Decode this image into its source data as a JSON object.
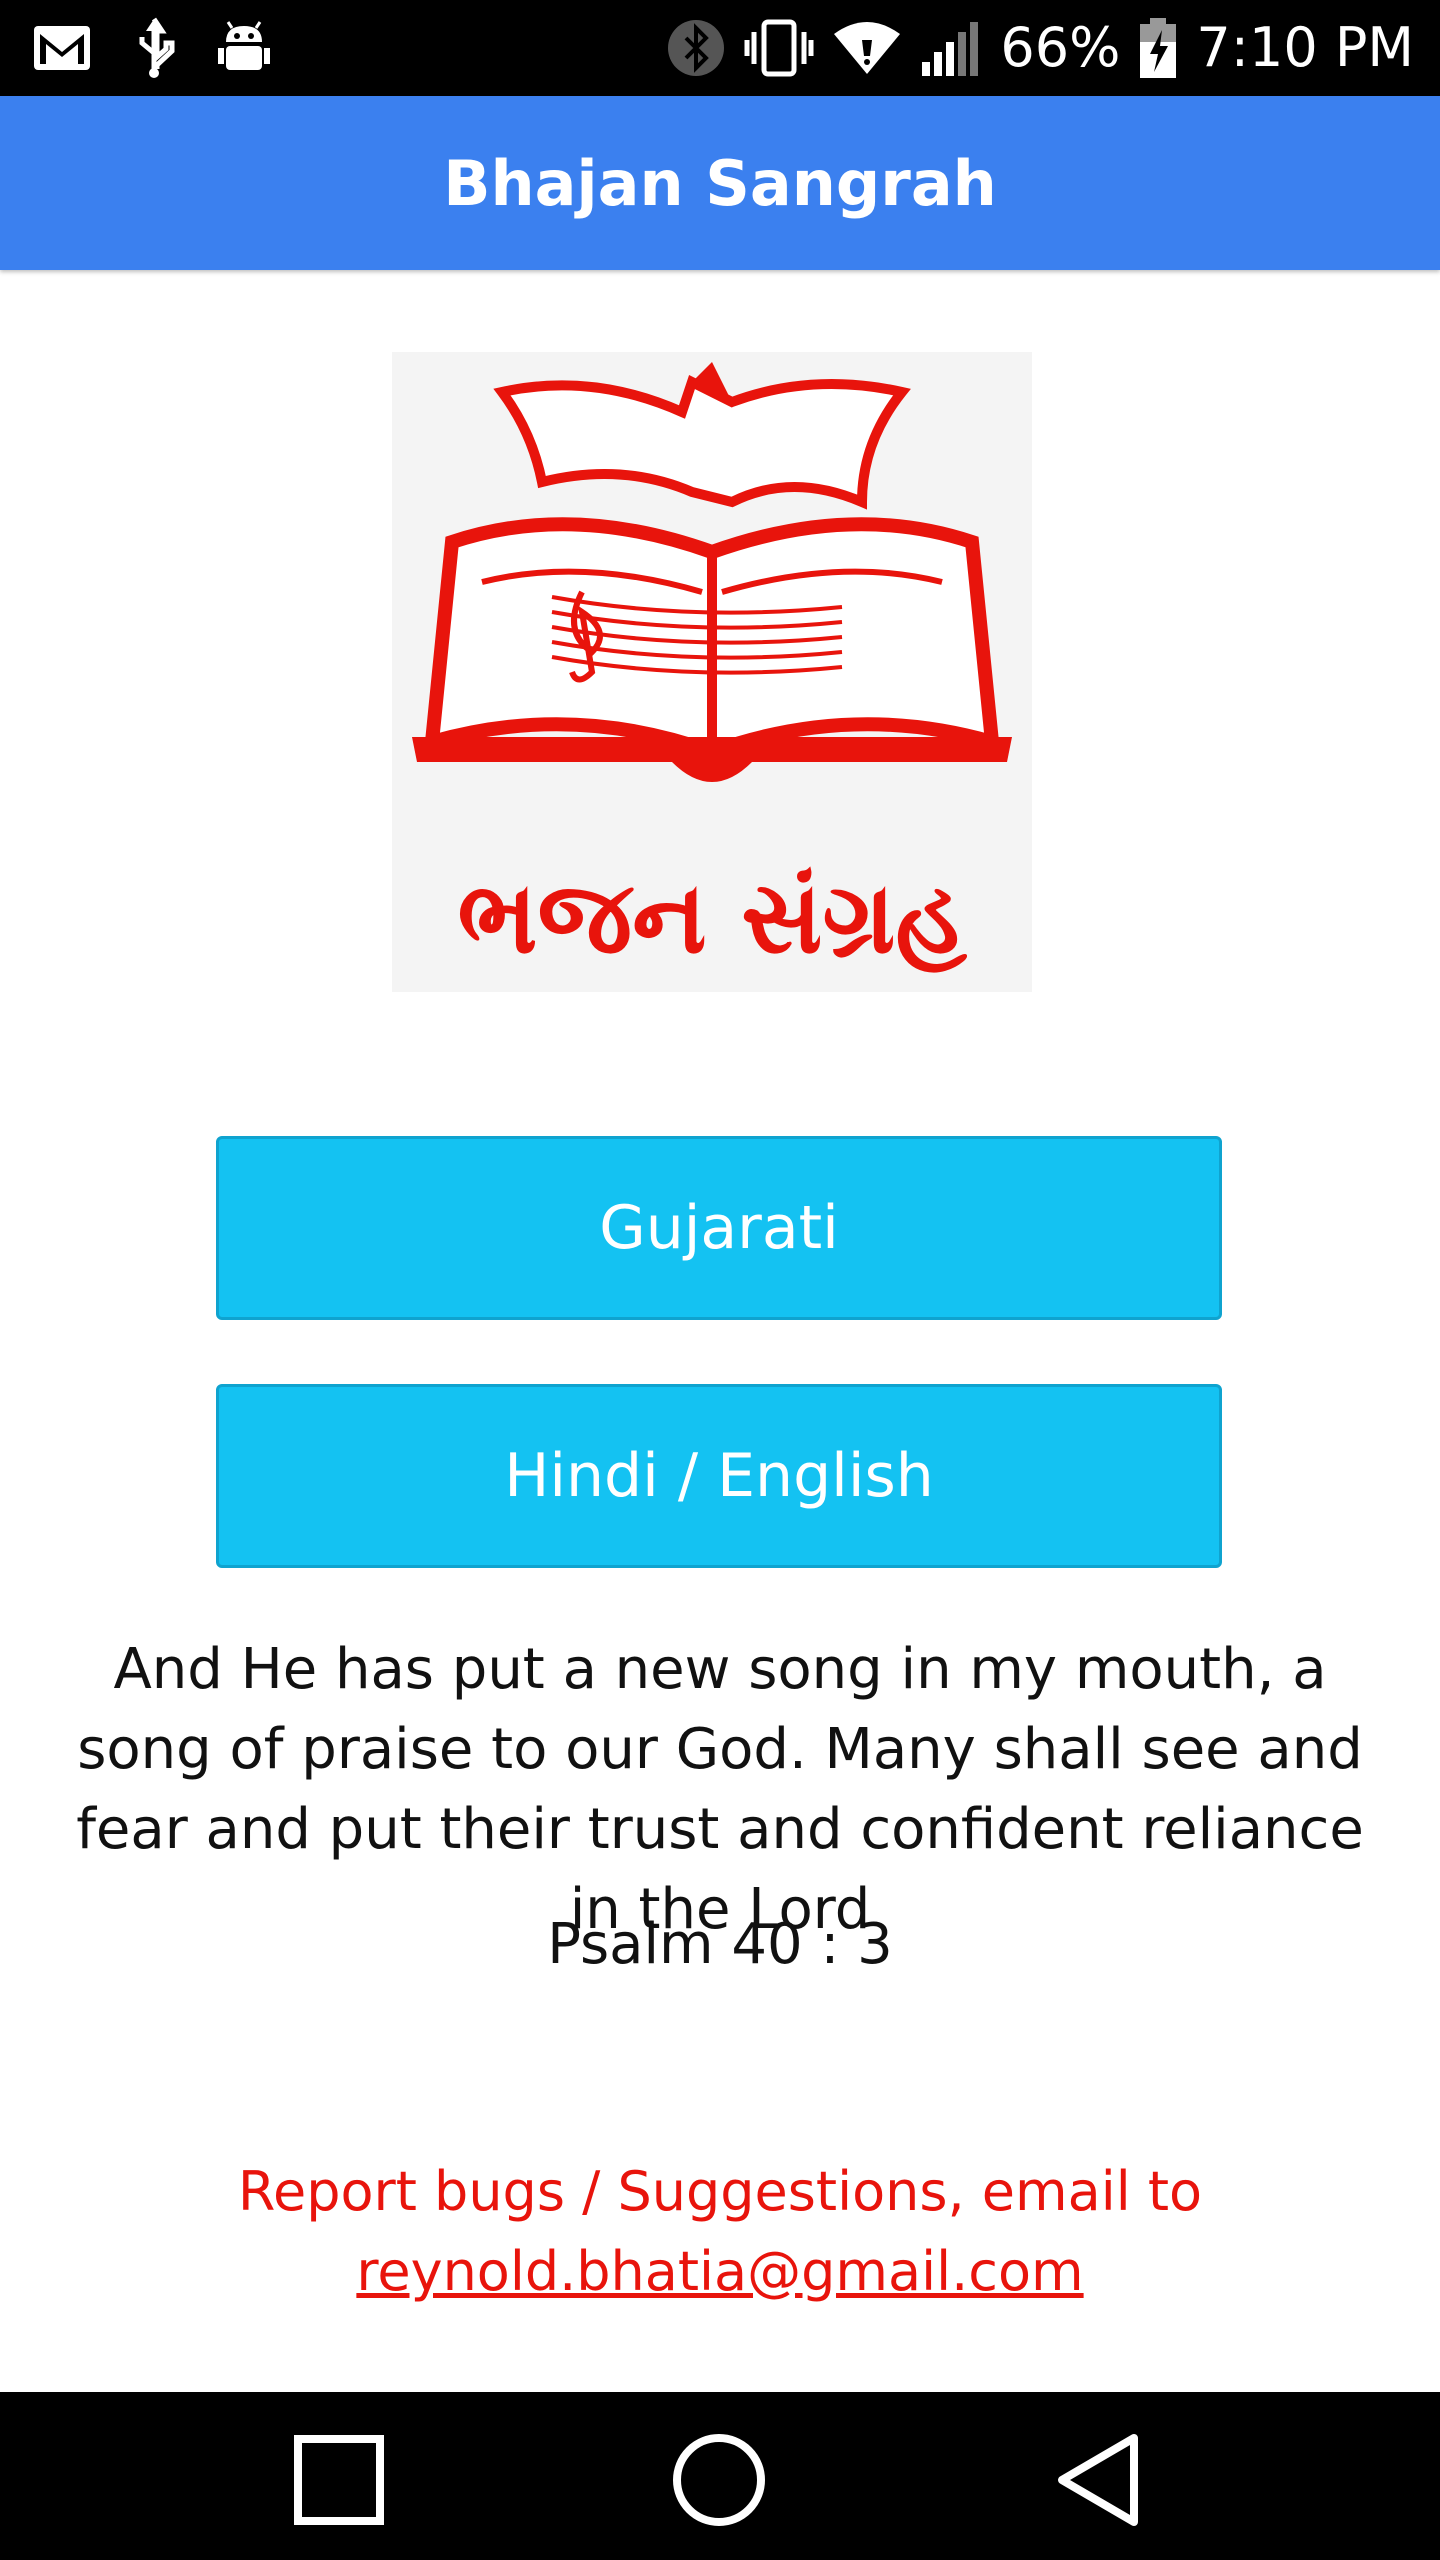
{
  "status_bar": {
    "battery": "66%",
    "time": "7:10 PM",
    "icons": [
      "gmail-icon",
      "usb-icon",
      "android-debug-icon",
      "bluetooth-icon",
      "vibrate-icon",
      "wifi-icon",
      "signal-icon",
      "battery-charging-icon"
    ]
  },
  "app_bar": {
    "title": "Bhajan Sangrah"
  },
  "logo": {
    "text": "ભજન સંગ્રહ",
    "color": "#e8140c"
  },
  "buttons": {
    "gujarati": "Gujarati",
    "hindi_english": "Hindi / English"
  },
  "verse": {
    "text": "And He has put a new song in my mouth, a song of praise to our God. Many shall see and fear and put their trust and confident reliance in the Lord",
    "reference": "Psalm 40 : 3"
  },
  "report": {
    "text": "Report bugs / Suggestions, email to",
    "email": "reynold.bhatia@gmail.com"
  },
  "colors": {
    "app_bar": "#3b80ef",
    "button": "#14c2f2",
    "report": "#e8140c"
  },
  "nav_bar": {
    "icons": [
      "recents-icon",
      "home-icon",
      "back-icon"
    ]
  }
}
